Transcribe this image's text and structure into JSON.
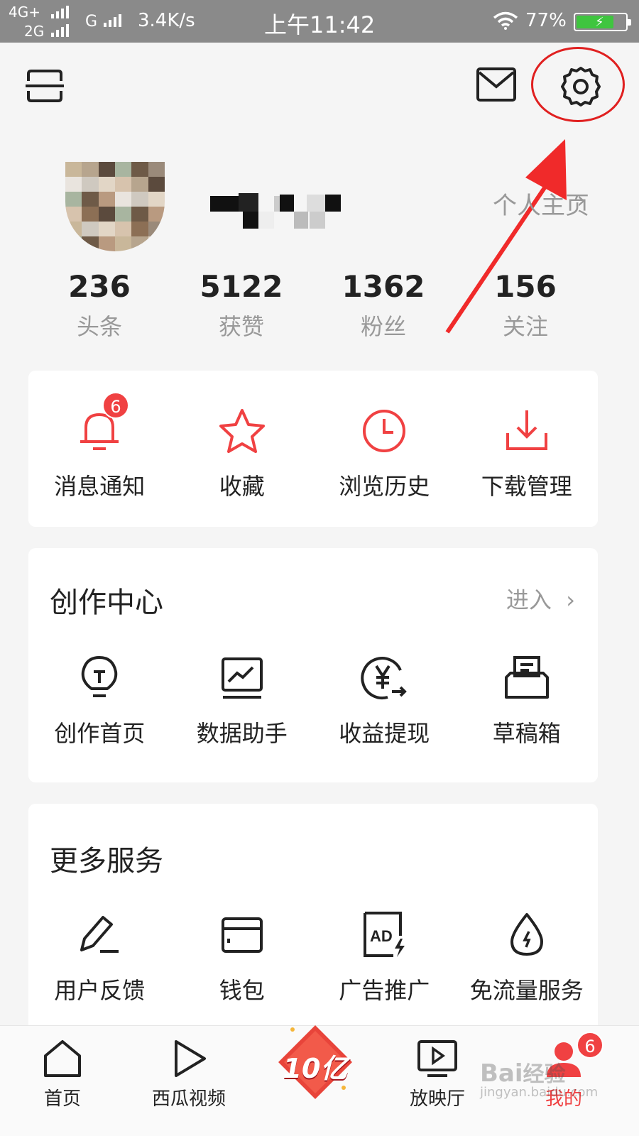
{
  "status_bar": {
    "network_primary": "4G+",
    "network_secondary": "2G",
    "network_g": "G",
    "speed": "3.4K/s",
    "time": "上午11:42",
    "battery_pct": "77%",
    "battery_level": 0.77
  },
  "profile": {
    "homepage_link": "个人主页",
    "homepage_chevron": "›"
  },
  "stats": [
    {
      "value": "236",
      "label": "头条"
    },
    {
      "value": "5122",
      "label": "获赞"
    },
    {
      "value": "1362",
      "label": "粉丝"
    },
    {
      "value": "156",
      "label": "关注"
    }
  ],
  "quick_actions": [
    {
      "label": "消息通知",
      "icon": "bell-icon",
      "badge": "6"
    },
    {
      "label": "收藏",
      "icon": "star-icon"
    },
    {
      "label": "浏览历史",
      "icon": "clock-icon"
    },
    {
      "label": "下载管理",
      "icon": "download-icon"
    }
  ],
  "creation_center": {
    "title": "创作中心",
    "enter_label": "进入",
    "chevron": "›",
    "items": [
      {
        "label": "创作首页",
        "icon": "lightbulb-icon"
      },
      {
        "label": "数据助手",
        "icon": "chart-icon"
      },
      {
        "label": "收益提现",
        "icon": "yen-withdraw-icon"
      },
      {
        "label": "草稿箱",
        "icon": "draft-box-icon"
      }
    ]
  },
  "more_services": {
    "title": "更多服务",
    "items": [
      {
        "label": "用户反馈",
        "icon": "pen-icon"
      },
      {
        "label": "钱包",
        "icon": "wallet-icon"
      },
      {
        "label": "广告推广",
        "icon": "ad-icon",
        "icon_text": "AD"
      },
      {
        "label": "免流量服务",
        "icon": "data-drop-icon"
      }
    ]
  },
  "tab_bar": {
    "tabs": [
      {
        "label": "首页",
        "icon": "home-icon"
      },
      {
        "label": "西瓜视频",
        "icon": "play-icon"
      },
      {
        "label": "放映厅",
        "icon": "tv-play-icon"
      },
      {
        "label": "我的",
        "icon": "profile-icon",
        "badge": "6"
      }
    ],
    "promo_text": "10亿"
  },
  "watermark": {
    "text": "Bai经验",
    "sub": "jingyan.baidu.com"
  },
  "colors": {
    "accent_red": "#f04142",
    "annotation_red": "#e02020",
    "text_dark": "#222222",
    "text_muted": "#999999",
    "background": "#f5f5f5",
    "status_bar": "#8a8a8a"
  }
}
